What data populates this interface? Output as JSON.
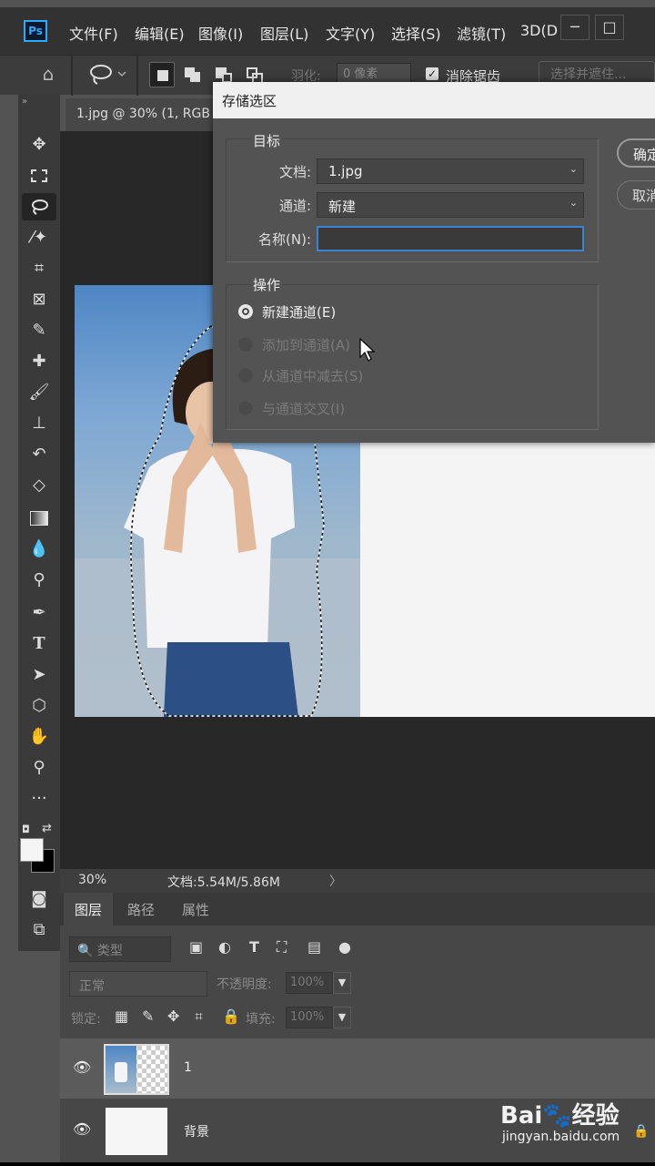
{
  "app": {
    "logo": "Ps",
    "menu": [
      "文件(F)",
      "编辑(E)",
      "图像(I)",
      "图层(L)",
      "文字(Y)",
      "选择(S)",
      "滤镜(T)",
      "3D(D"
    ],
    "window_controls": [
      "─",
      "□"
    ]
  },
  "options_bar": {
    "feather_label": "羽化:",
    "feather_value": "0 像素",
    "antialias_checked": true,
    "antialias_label": "消除锯齿",
    "select_and_mask": "选择并遮住..."
  },
  "document": {
    "tab_title": "1.jpg @ 30% (1, RGB"
  },
  "status": {
    "zoom": "30%",
    "doc_size": "文档:5.54M/5.86M",
    "arrow": "〉"
  },
  "toolbar": {
    "tools": [
      "move-tool",
      "marquee-tool",
      "lasso-tool",
      "magic-wand-tool",
      "crop-tool",
      "frame-tool",
      "eyedropper-tool",
      "healing-tool",
      "brush-tool",
      "stamp-tool",
      "history-brush-tool",
      "eraser-tool",
      "gradient-tool",
      "blur-tool",
      "dodge-tool",
      "pen-tool",
      "type-tool",
      "path-select-tool",
      "shape-tool",
      "hand-tool",
      "zoom-tool",
      "more-tools"
    ],
    "active_tool": "lasso-tool",
    "foreground_color": "#f5f5f5",
    "background_color": "#000000"
  },
  "panel": {
    "tabs": [
      "图层",
      "路径",
      "属性"
    ],
    "active_tab": "图层",
    "filter_kind": "类型",
    "blend_mode": "正常",
    "opacity_label": "不透明度:",
    "opacity_value": "100%",
    "lock_label": "锁定:",
    "fill_label": "填充:",
    "fill_value": "100%",
    "layers": [
      {
        "name": "1",
        "visible": true,
        "selected": true
      },
      {
        "name": "背景",
        "visible": true,
        "selected": false
      }
    ]
  },
  "dialog": {
    "title": "存储选区",
    "target_group": "目标",
    "document_label": "文档:",
    "document_value": "1.jpg",
    "channel_label": "通道:",
    "channel_value": "新建",
    "name_label": "名称(N):",
    "name_value": "",
    "operation_group": "操作",
    "operations": [
      {
        "label": "新建通道(E)",
        "selected": true,
        "enabled": true
      },
      {
        "label": "添加到通道(A)",
        "selected": false,
        "enabled": false
      },
      {
        "label": "从通道中减去(S)",
        "selected": false,
        "enabled": false
      },
      {
        "label": "与通道交叉(I)",
        "selected": false,
        "enabled": false
      }
    ],
    "ok_button": "确定",
    "cancel_button": "取消",
    "accent": "#3c84d2"
  },
  "watermark": {
    "logo": "Bai🐾经验",
    "url": "jingyan.baidu.com"
  }
}
